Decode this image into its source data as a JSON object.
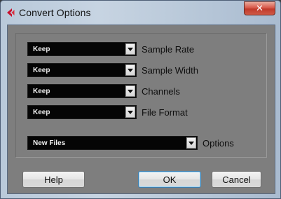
{
  "window": {
    "title": "Convert Options",
    "close_glyph": "✕",
    "app_icon": "cubase-logo-icon"
  },
  "settings": [
    {
      "value": "Keep",
      "label": "Sample Rate"
    },
    {
      "value": "Keep",
      "label": "Sample Width"
    },
    {
      "value": "Keep",
      "label": "Channels"
    },
    {
      "value": "Keep",
      "label": "File Format"
    }
  ],
  "options": {
    "value": "New Files",
    "label": "Options"
  },
  "buttons": {
    "help": "Help",
    "ok": "OK",
    "cancel": "Cancel"
  },
  "colors": {
    "accent": "#c8102e",
    "close": "#c03a2b",
    "panel": "#7e7e7e"
  }
}
